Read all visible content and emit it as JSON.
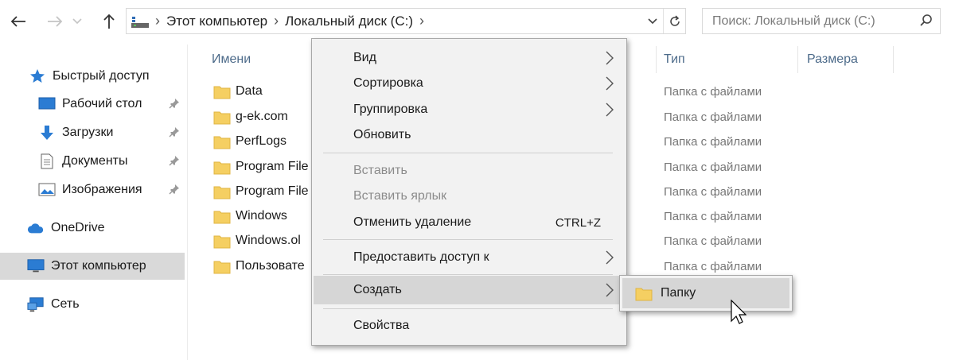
{
  "address_bar": {
    "crumbs": [
      "Этот компьютер",
      "Локальный диск (C:)"
    ]
  },
  "search": {
    "placeholder": "Поиск: Локальный диск (C:)"
  },
  "sidebar": {
    "items": [
      {
        "label": "Быстрый доступ",
        "icon": "star-icon"
      },
      {
        "label": "Рабочий стол",
        "icon": "desktop-icon",
        "pinned": true
      },
      {
        "label": "Загрузки",
        "icon": "download-arrow-icon",
        "pinned": true
      },
      {
        "label": "Документы",
        "icon": "document-icon",
        "pinned": true
      },
      {
        "label": "Изображения",
        "icon": "pictures-icon",
        "pinned": true
      },
      {
        "label": "OneDrive",
        "icon": "cloud-icon"
      },
      {
        "label": "Этот компьютер",
        "icon": "computer-icon",
        "selected": true
      },
      {
        "label": "Сеть",
        "icon": "network-icon"
      }
    ]
  },
  "columns": {
    "name": "Имени",
    "type": "Тип",
    "size": "Размера"
  },
  "files": [
    {
      "name": "Data",
      "type": "Папка с файлами"
    },
    {
      "name": "g-ek.com",
      "type": "Папка с файлами"
    },
    {
      "name": "PerfLogs",
      "type": "Папка с файлами"
    },
    {
      "name": "Program File",
      "type": "Папка с файлами"
    },
    {
      "name": "Program File",
      "type": "Папка с файлами"
    },
    {
      "name": "Windows",
      "type": "Папка с файлами"
    },
    {
      "name": "Windows.ol",
      "type": "Папка с файлами"
    },
    {
      "name": "Пользовате",
      "type": "Папка с файлами"
    }
  ],
  "context_menu": {
    "view": "Вид",
    "sort": "Сортировка",
    "group": "Группировка",
    "refresh": "Обновить",
    "paste": "Вставить",
    "paste_shortcut": "Вставить ярлык",
    "undo_delete": "Отменить удаление",
    "undo_shortcut": "CTRL+Z",
    "share": "Предоставить доступ к",
    "create": "Создать",
    "properties": "Свойства"
  },
  "submenu": {
    "folder": "Папку"
  },
  "colors": {
    "folder_yellow": "#f5cf62",
    "header_text": "#4d6b8a",
    "menu_bg": "#f2f2f2",
    "highlight": "#d6d6d6"
  }
}
